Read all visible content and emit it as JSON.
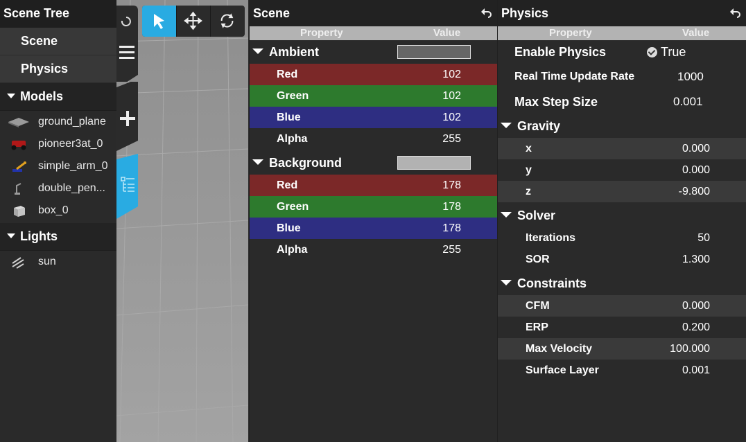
{
  "tree": {
    "title": "Scene Tree",
    "nav": [
      "Scene",
      "Physics"
    ],
    "models_label": "Models",
    "models": [
      {
        "name": "ground_plane",
        "icon": "ground-plane-icon"
      },
      {
        "name": "pioneer3at_0",
        "icon": "pioneer-robot-icon"
      },
      {
        "name": "simple_arm_0",
        "icon": "arm-icon"
      },
      {
        "name": "double_pen...",
        "icon": "pendulum-icon"
      },
      {
        "name": "box_0",
        "icon": "box-icon"
      }
    ],
    "lights_label": "Lights",
    "lights": [
      {
        "name": "sun",
        "icon": "sun-light-icon"
      }
    ]
  },
  "scene": {
    "title": "Scene",
    "header": {
      "property": "Property",
      "value": "Value"
    },
    "ambient": {
      "label": "Ambient",
      "swatch_color": "#666666",
      "rows": [
        {
          "label": "Red",
          "value": "102",
          "tone": "red"
        },
        {
          "label": "Green",
          "value": "102",
          "tone": "green"
        },
        {
          "label": "Blue",
          "value": "102",
          "tone": "blue"
        },
        {
          "label": "Alpha",
          "value": "255",
          "tone": "plain"
        }
      ]
    },
    "background": {
      "label": "Background",
      "swatch_color": "#b2b2b2",
      "rows": [
        {
          "label": "Red",
          "value": "178",
          "tone": "red"
        },
        {
          "label": "Green",
          "value": "178",
          "tone": "green"
        },
        {
          "label": "Blue",
          "value": "178",
          "tone": "blue"
        },
        {
          "label": "Alpha",
          "value": "255",
          "tone": "plain"
        }
      ]
    }
  },
  "physics": {
    "title": "Physics",
    "header": {
      "property": "Property",
      "value": "Value"
    },
    "enable_label": "Enable Physics",
    "enable_value": "True",
    "rtur_label": "Real Time Update Rate",
    "rtur_value": "1000",
    "mss_label": "Max Step Size",
    "mss_value": "0.001",
    "gravity": {
      "label": "Gravity",
      "rows": [
        {
          "label": "x",
          "value": "0.000"
        },
        {
          "label": "y",
          "value": "0.000"
        },
        {
          "label": "z",
          "value": "-9.800"
        }
      ]
    },
    "solver": {
      "label": "Solver",
      "rows": [
        {
          "label": "Iterations",
          "value": "50"
        },
        {
          "label": "SOR",
          "value": "1.300"
        }
      ]
    },
    "constraints": {
      "label": "Constraints",
      "rows": [
        {
          "label": "CFM",
          "value": "0.000"
        },
        {
          "label": "ERP",
          "value": "0.200"
        },
        {
          "label": "Max Velocity",
          "value": "100.000"
        },
        {
          "label": "Surface Layer",
          "value": "0.001"
        }
      ]
    }
  },
  "colors": {
    "accent": "#29abe2",
    "red_row": "#7b2828",
    "green_row": "#2d7a2d",
    "blue_row": "#2e2e82"
  }
}
